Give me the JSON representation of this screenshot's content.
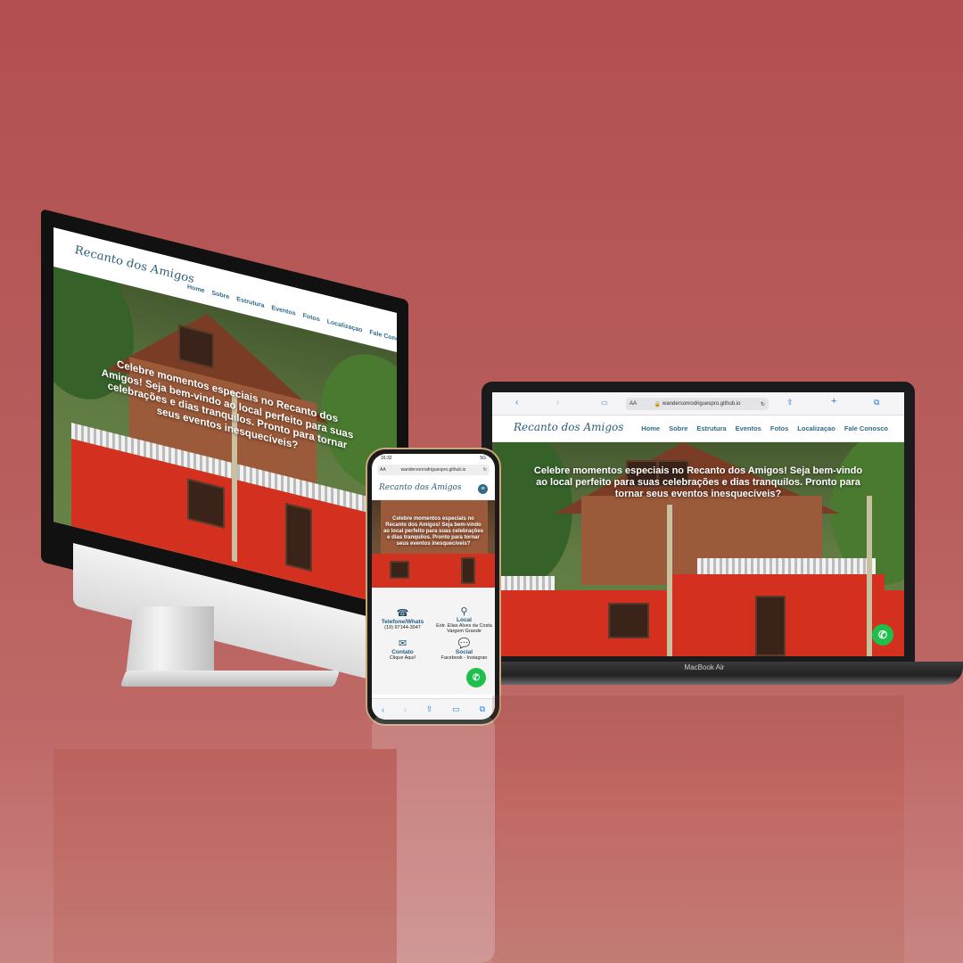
{
  "site": {
    "logo": "Recanto dos Amigos",
    "nav": [
      "Home",
      "Sobre",
      "Estrutura",
      "Eventos",
      "Fotos",
      "Localizaçao",
      "Fale Conosco"
    ],
    "hero_text": "Celebre momentos especiais no Recanto dos Amigos! Seja bem-vindo ao local perfeito para suas celebrações e dias tranquilos. Pronto para tornar seus eventos inesquecíveis?",
    "whatsapp_icon": "whatsapp-icon"
  },
  "macbook": {
    "url": "wandersonrodriguespro.github.io",
    "text_size": "AA",
    "brand": "MacBook Air"
  },
  "phone": {
    "time": "16:32",
    "signal": "5G",
    "url": "wandersonrodriguespro.github.io",
    "text_size": "AA",
    "contact": {
      "phone_title": "Telefone/Whats",
      "phone_value": "(19) 97144-3047",
      "local_title": "Local",
      "local_value": "Estr. Elias Alves da Costa Vargem Grande",
      "contato_title": "Contato",
      "contato_value": "Clique Aqui!",
      "social_title": "Social",
      "social_value": "Facebook - Instagran"
    }
  },
  "colors": {
    "background": "#b24f4f",
    "brand_blue": "#2f6c8a",
    "wall_red": "#d3301f",
    "whatsapp_green": "#1fbf4c"
  }
}
